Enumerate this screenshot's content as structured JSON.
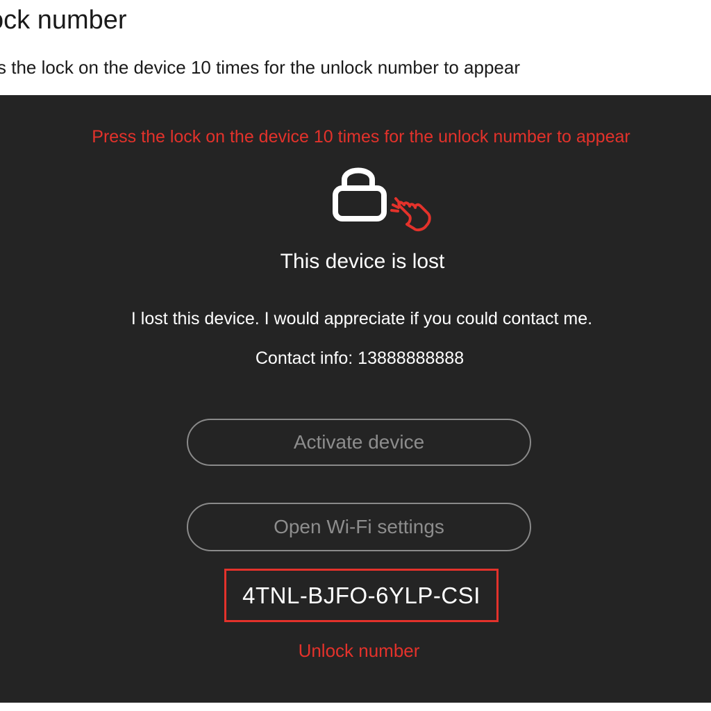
{
  "header": {
    "title": "ock number",
    "subtitle": "s the lock on the device 10 times for the unlock number to appear"
  },
  "screen": {
    "hint": "Press the lock on the device 10 times for the unlock number to appear",
    "lock_icon": "lock-icon",
    "pointer_icon": "hand-pointer-icon",
    "status_title": "This device is lost",
    "message": "I lost this device. I would appreciate if you could contact me.",
    "contact": "Contact info: 13888888888",
    "activate_button": "Activate device",
    "wifi_button": "Open Wi-Fi settings",
    "unlock_code": "4TNL-BJFO-6YLP-CSI",
    "unlock_label": "Unlock number"
  },
  "colors": {
    "background": "#242424",
    "accent_red": "#e3322b",
    "button_border": "#8a8a8a",
    "button_text": "#8d8d8d"
  }
}
